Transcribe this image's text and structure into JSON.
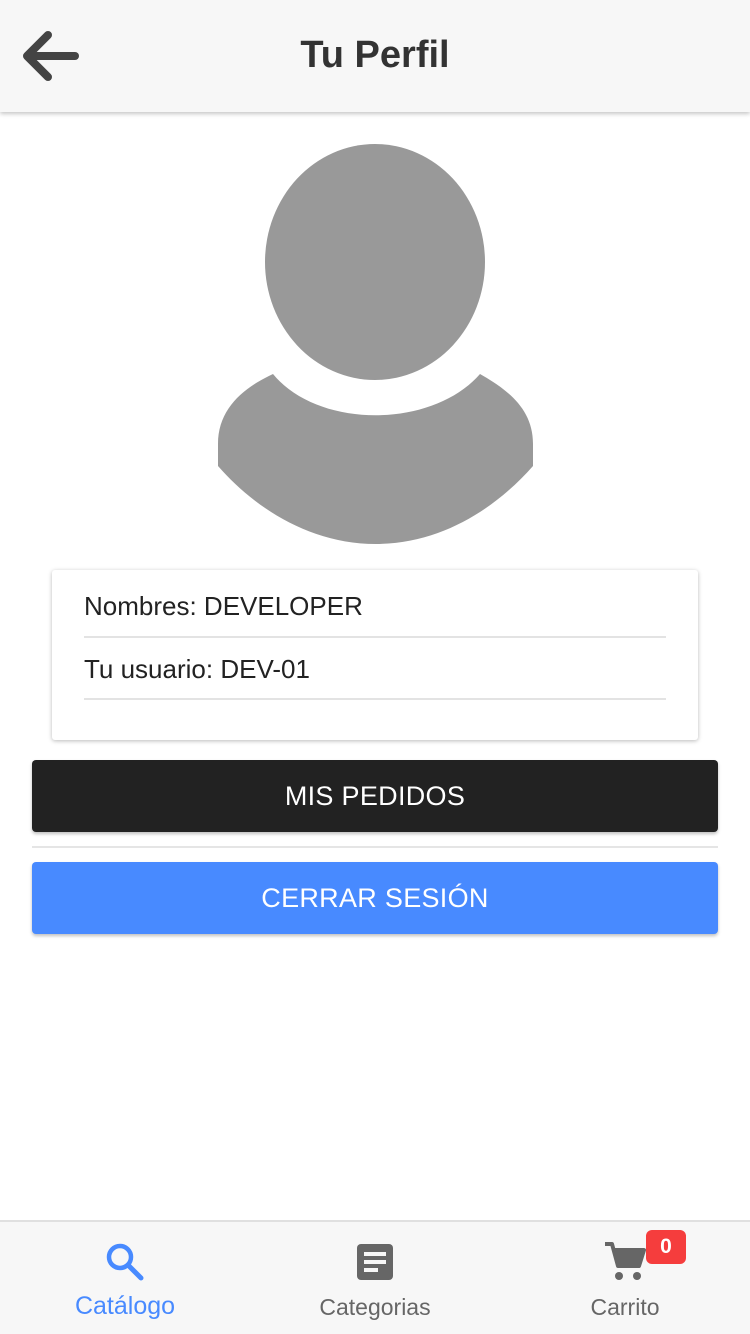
{
  "header": {
    "title": "Tu Perfil",
    "back_icon": "arrow-back-icon"
  },
  "avatar": {
    "icon": "person-silhouette-icon",
    "color": "#999999"
  },
  "profile": {
    "name_label": "Nombres: DEVELOPER",
    "user_label": "Tu usuario: DEV-01"
  },
  "actions": {
    "orders_label": "MIS PEDIDOS",
    "orders_color": "#222222",
    "logout_label": "CERRAR SESIÓN",
    "logout_color": "#488aff"
  },
  "tabs": [
    {
      "label": "Catálogo",
      "icon": "search-icon",
      "active": true
    },
    {
      "label": "Categorias",
      "icon": "document-list-icon",
      "active": false
    },
    {
      "label": "Carrito",
      "icon": "cart-icon",
      "active": false,
      "badge": "0"
    }
  ],
  "colors": {
    "accent": "#488aff",
    "badge": "#f53d3d",
    "header_bg": "#f7f7f7"
  }
}
